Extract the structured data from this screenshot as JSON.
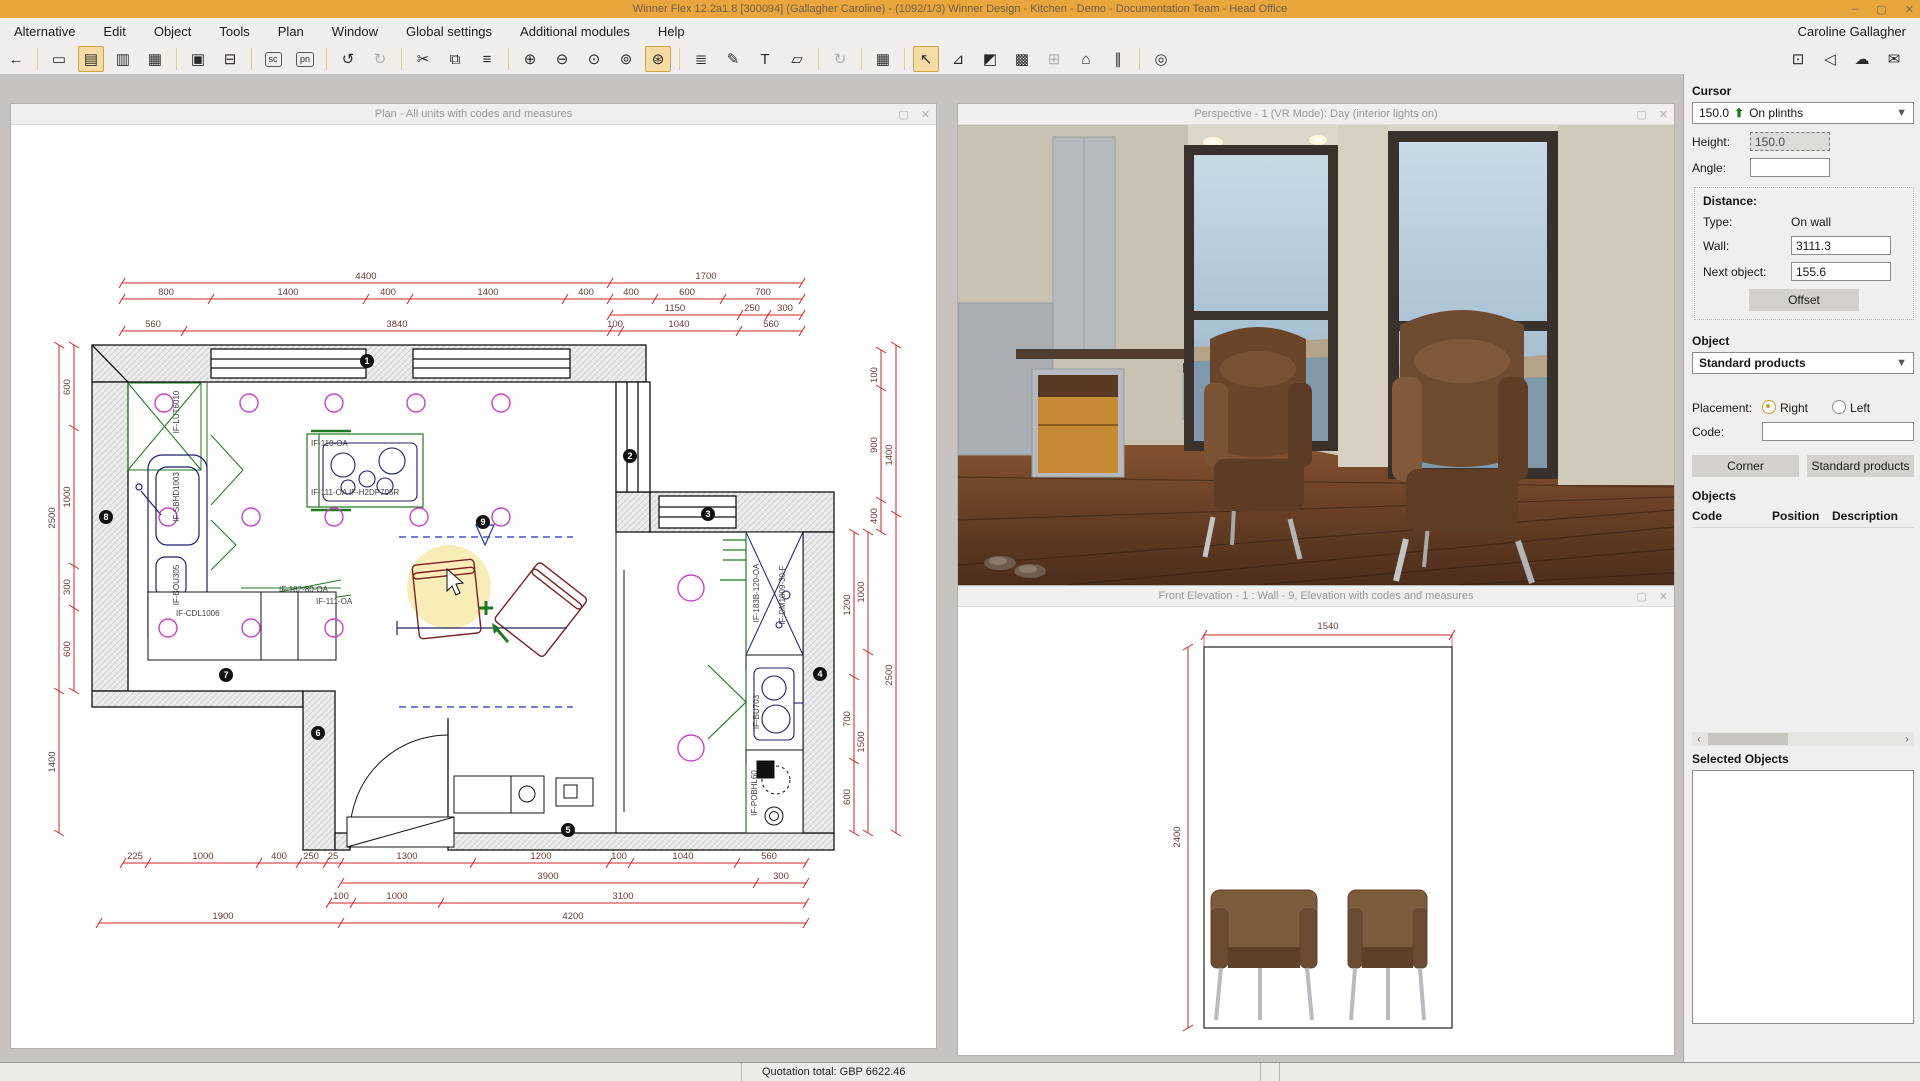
{
  "title_bar": {
    "title": "Winner Flex 12.2a1.8  [300094]  (Gallagher Caroline) - (1092/1/3) Winner Design - Kitchen - Demo - Documentation Team - Head Office",
    "minimize": "–",
    "maximize": "▢",
    "close": "✕"
  },
  "menu": {
    "items": [
      "Alternative",
      "Edit",
      "Object",
      "Tools",
      "Plan",
      "Window",
      "Global settings",
      "Additional modules",
      "Help"
    ],
    "user": "Caroline Gallagher"
  },
  "toolbar": {
    "icons": [
      {
        "name": "back",
        "glyph": "←"
      },
      {
        "name": "new-plan",
        "glyph": "▭"
      },
      {
        "name": "plan-view",
        "glyph": "▤"
      },
      {
        "name": "elevation-view",
        "glyph": "▥"
      },
      {
        "name": "view-list",
        "glyph": "▦"
      },
      {
        "name": "save",
        "glyph": "▣"
      },
      {
        "name": "print",
        "glyph": "⊟"
      },
      {
        "name": "sc",
        "glyph": "sc"
      },
      {
        "name": "pn",
        "glyph": "pn"
      },
      {
        "name": "undo",
        "glyph": "↺"
      },
      {
        "name": "redo",
        "glyph": "↻"
      },
      {
        "name": "cut",
        "glyph": "✂"
      },
      {
        "name": "copy",
        "glyph": "⧉"
      },
      {
        "name": "paste",
        "glyph": "≡"
      },
      {
        "name": "zoom-in",
        "glyph": "⊕"
      },
      {
        "name": "zoom-out",
        "glyph": "⊖"
      },
      {
        "name": "zoom-previous",
        "glyph": "⊙"
      },
      {
        "name": "zoom-all",
        "glyph": "⊚"
      },
      {
        "name": "zoom-window",
        "glyph": "⊛"
      },
      {
        "name": "line-tool",
        "glyph": "≣"
      },
      {
        "name": "note-tool",
        "glyph": "✎"
      },
      {
        "name": "text-tool",
        "glyph": "T"
      },
      {
        "name": "measure-tool",
        "glyph": "▱"
      },
      {
        "name": "refresh",
        "glyph": "↻"
      },
      {
        "name": "calculator",
        "glyph": "▦"
      },
      {
        "name": "select-arrow",
        "glyph": "↖"
      },
      {
        "name": "wall-tool-1",
        "glyph": "⊿"
      },
      {
        "name": "wall-tool-2",
        "glyph": "◩"
      },
      {
        "name": "wall-tool-3",
        "glyph": "▩"
      },
      {
        "name": "grid",
        "glyph": "⊞"
      },
      {
        "name": "walkthrough",
        "glyph": "⌂"
      },
      {
        "name": "align",
        "glyph": "∥"
      },
      {
        "name": "plan-stamp",
        "glyph": "◎"
      },
      {
        "name": "camera",
        "glyph": "⊡"
      },
      {
        "name": "share",
        "glyph": "◁"
      },
      {
        "name": "cloud-print",
        "glyph": "☁"
      },
      {
        "name": "mail",
        "glyph": "✉"
      }
    ]
  },
  "windows": {
    "plan": {
      "title": "Plan - All units with codes and measures"
    },
    "perspective": {
      "title": "Perspective - 1 (VR Mode): Day (interior lights on)"
    },
    "elevation": {
      "title": "Front Elevation - 1 : Wall - 9, Elevation with codes and measures",
      "top_dim": "1540",
      "left_dim": "2400"
    }
  },
  "plan": {
    "dims": {
      "t1": [
        "4400",
        "1700"
      ],
      "t2": [
        "800",
        "1400",
        "400",
        "1400",
        "400",
        "400",
        "600",
        "700"
      ],
      "t3": [
        "1150",
        "250",
        "300"
      ],
      "t4": [
        "560",
        "3840",
        "100",
        "1040",
        "560"
      ],
      "b1": [
        "225",
        "1000",
        "400",
        "250",
        "25",
        "1300",
        "1200",
        "100",
        "1040",
        "560"
      ],
      "b2": [
        "3900",
        "300"
      ],
      "b3": [
        "100",
        "1000",
        "3100"
      ],
      "b4": [
        "1900",
        "4200"
      ],
      "li": [
        "600",
        "1000",
        "300",
        "600"
      ],
      "lo": [
        "2500",
        "1400"
      ],
      "ra": [
        "1200",
        "700",
        "600"
      ],
      "rb": [
        "1000",
        "1500"
      ],
      "rc": [
        "100",
        "900",
        "400"
      ],
      "rd": [
        "1400",
        "2500"
      ]
    },
    "labels": {
      "l1": "IF-LUT6010",
      "l2": "IF-SBHD1003",
      "l3": "IF-BOU305",
      "l4": "IF-CDL1006",
      "l5": "IF-182-80-OA",
      "l6": "IF-111-OA",
      "l7": "IF-110-OA",
      "l8": "IF-111-OA IF-H2DP705R",
      "l9": "IF-183B-120-OA",
      "l10": "IF-DM1009-30-F",
      "l11": "IF-BU703",
      "l12": "IF-POBHL60"
    },
    "markers": [
      "1",
      "2",
      "3",
      "4",
      "5",
      "6",
      "7",
      "8",
      "9"
    ]
  },
  "sidebar": {
    "cursor": {
      "label": "Cursor",
      "mode_value": "150.0",
      "mode_arrow": "⬆",
      "mode_text": "On plinths",
      "height_label": "Height:",
      "height_value": "150.0",
      "angle_label": "Angle:",
      "angle_value": "",
      "distance_label": "Distance:",
      "type_label": "Type:",
      "type_value": "On wall",
      "wall_label": "Wall:",
      "wall_value": "3111.3",
      "next_label": "Next object:",
      "next_value": "155.6",
      "offset_button": "Offset"
    },
    "object": {
      "label": "Object",
      "dropdown": "Standard products",
      "placement_label": "Placement:",
      "right_label": "Right",
      "left_label": "Left",
      "code_label": "Code:",
      "corner_button": "Corner",
      "standard_button": "Standard products"
    },
    "objects": {
      "label": "Objects",
      "col_code": "Code",
      "col_position": "Position",
      "col_description": "Description"
    },
    "selected": {
      "label": "Selected Objects"
    }
  },
  "status": {
    "quotation": "Quotation total: GBP 6622.46"
  }
}
